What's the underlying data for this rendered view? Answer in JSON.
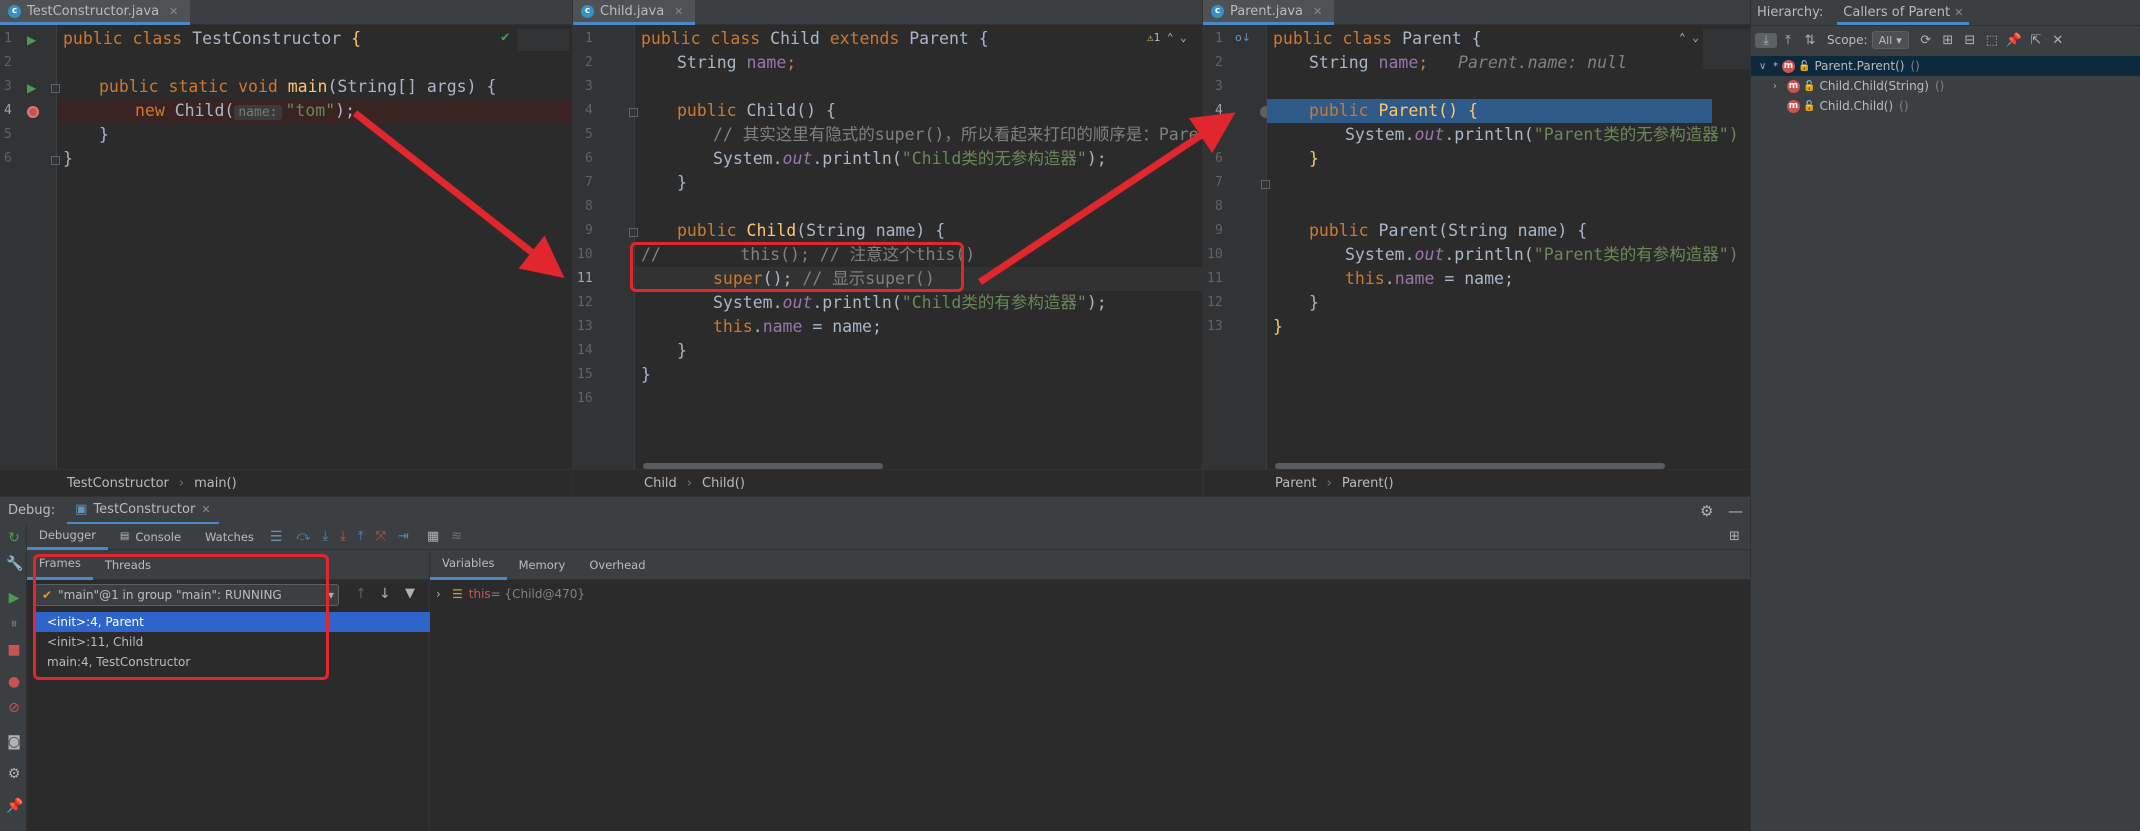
{
  "editors": {
    "left": {
      "tab": "TestConstructor.java",
      "lines": [
        "1",
        "2",
        "3",
        "4",
        "5",
        "6"
      ],
      "breadcrumb": [
        "TestConstructor",
        "main()"
      ]
    },
    "middle": {
      "tab": "Child.java",
      "lines": [
        "1",
        "2",
        "3",
        "4",
        "5",
        "6",
        "7",
        "8",
        "9",
        "10",
        "11",
        "12",
        "13",
        "14",
        "15",
        "16"
      ],
      "breadcrumb": [
        "Child",
        "Child()"
      ],
      "warning": "1"
    },
    "right": {
      "tab": "Parent.java",
      "lines": [
        "1",
        "2",
        "3",
        "4",
        "5",
        "6",
        "7",
        "8",
        "9",
        "10",
        "11",
        "12",
        "13"
      ],
      "breadcrumb": [
        "Parent",
        "Parent()"
      ]
    }
  },
  "code": {
    "l1_kw": "public class ",
    "l1_name": "TestConstructor ",
    "l1_brace": "{",
    "l3_kw": "public static void ",
    "l3_fn": "main",
    "l3_rest": "(String[] args) {",
    "l4_kw": "new ",
    "l4_cls": "Child(",
    "l4_hint": "name:",
    "l4_str": "\"tom\"",
    "l4_end": ");",
    "close": "}",
    "c1_a": "public class ",
    "c1_b": "Child ",
    "c1_c": "extends ",
    "c1_d": "Parent {",
    "c2_a": "String ",
    "c2_b": "name",
    "c2_c": ";",
    "c4_a": "public ",
    "c4_b": "Child",
    "c4_c": "() {",
    "c5": "// 其实这里有隐式的super()，所以看起来打印的顺序是：Pare",
    "c6_a": "System.",
    "c6_b": "out",
    "c6_c": ".println(",
    "c6_d": "\"Child类的无参构造器\"",
    "c6_e": ");",
    "c9_a": "public ",
    "c9_b": "Child",
    "c9_c": "(String name) {",
    "c10": "//        this(); // 注意这个this()",
    "c11_a": "super",
    "c11_b": "(); ",
    "c11_c": "// 显示super()",
    "c12_d": "\"Child类的有参构造器\"",
    "c13_a": "this",
    "c13_b": ".",
    "c13_c": "name",
    "c13_d": " = name;",
    "p1_a": "public class ",
    "p1_b": "Parent {",
    "p2_a": "String ",
    "p2_b": "name",
    "p2_c": ";",
    "p2_hint": "Parent.name: null",
    "p4_a": "public ",
    "p4_b": "Parent",
    "p4_c": "() {",
    "p5_d": "\"Parent类的无参构造器\")",
    "p8_a": "public ",
    "p8_b": "Parent",
    "p8_c": "(String name) {",
    "p9_d": "\"Parent类的有参构造器\")"
  },
  "debug": {
    "label": "Debug:",
    "session": "TestConstructor",
    "tabs": [
      "Debugger",
      "Console",
      "Watches"
    ],
    "frames_tabs": [
      "Frames",
      "Threads"
    ],
    "thread": "\"main\"@1 in group \"main\": RUNNING",
    "frames": [
      "<init>:4, Parent",
      "<init>:11, Child",
      "main:4, TestConstructor"
    ],
    "var_tabs": [
      "Variables",
      "Memory",
      "Overhead"
    ],
    "var_name": "this",
    "var_value": " = {Child@470}"
  },
  "hierarchy": {
    "label": "Hierarchy:",
    "tab": "Callers of Parent",
    "scope_label": "Scope:",
    "scope_value": "All",
    "nodes": [
      "Parent.Parent()",
      "Child.Child(String)",
      "Child.Child()"
    ],
    "node_suffix": "()"
  },
  "colors": {
    "accent": "#4a88c7",
    "annotation_red": "#e2262e",
    "selected_row": "#2f65ca",
    "execution_line": "#2d5a88"
  }
}
